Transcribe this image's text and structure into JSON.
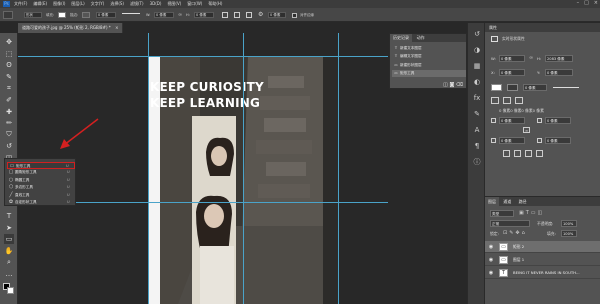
{
  "menubar": {
    "logo": "Ps",
    "items": [
      "文件(F)",
      "编辑(E)",
      "图像(I)",
      "图层(L)",
      "文字(Y)",
      "选择(S)",
      "滤镜(T)",
      "3D(D)",
      "视图(V)",
      "窗口(W)",
      "帮助(H)"
    ],
    "window_buttons": [
      "–",
      "□",
      "×"
    ]
  },
  "options": {
    "mode": "形状",
    "fill_label": "填充:",
    "stroke_label": "描边:",
    "stroke_width": "0 像素",
    "w_label": "W:",
    "w_value": "0 像素",
    "h_label": "H:",
    "h_value": "0 像素",
    "radius_value": "0 像素",
    "align_edges": "对齐边缘"
  },
  "tabs": [
    {
      "label": "道路可爱的孩子.jpg @ 25% (矩形 2, RGB/8#) *",
      "close": "×"
    }
  ],
  "toolbar": {
    "tools": [
      "move-icon",
      "marquee-icon",
      "lasso-icon",
      "quick-select-icon",
      "crop-icon",
      "eyedropper-icon",
      "heal-icon",
      "brush-icon",
      "stamp-icon",
      "history-brush-icon",
      "eraser-icon",
      "gradient-icon",
      "blur-icon",
      "dodge-icon",
      "pen-icon",
      "type-icon",
      "path-select-icon",
      "rectangle-icon",
      "hand-icon",
      "zoom-icon",
      "more-icon"
    ],
    "glyphs": [
      "✥",
      "⬚",
      "ʘ",
      "✎",
      "⌗",
      "✐",
      "✚",
      "✏",
      "⛉",
      "↺",
      "◫",
      "▦",
      "◉",
      "◐",
      "✒",
      "T",
      "➤",
      "▭",
      "✋",
      "⌕",
      "…"
    ]
  },
  "flyout": {
    "items": [
      {
        "label": "矩形工具",
        "key": "U",
        "glyph": "▭",
        "icon": "rectangle-tool-icon"
      },
      {
        "label": "圆角矩形工具",
        "key": "U",
        "glyph": "▢",
        "icon": "rounded-rectangle-tool-icon"
      },
      {
        "label": "椭圆工具",
        "key": "U",
        "glyph": "○",
        "icon": "ellipse-tool-icon"
      },
      {
        "label": "多边形工具",
        "key": "U",
        "glyph": "⬡",
        "icon": "polygon-tool-icon"
      },
      {
        "label": "直线工具",
        "key": "U",
        "glyph": "╱",
        "icon": "line-tool-icon"
      },
      {
        "label": "自定形状工具",
        "key": "U",
        "glyph": "✿",
        "icon": "custom-shape-tool-icon"
      }
    ]
  },
  "canvas": {
    "headline_1": "KEEP CURIOSITY",
    "headline_2": "KEEP LEARNING"
  },
  "history": {
    "tabs": [
      "历史记录",
      "动作"
    ],
    "rows": [
      {
        "label": "新建文本图层",
        "glyph": "T",
        "icon": "type-layer-icon"
      },
      {
        "label": "编辑文字图层",
        "glyph": "T",
        "icon": "type-layer-icon"
      },
      {
        "label": "新建形状图层",
        "glyph": "▭",
        "icon": "shape-layer-icon"
      },
      {
        "label": "矩形工具",
        "glyph": "▭",
        "icon": "rectangle-tool-icon"
      }
    ]
  },
  "properties": {
    "tab": "属性",
    "title": "实时形状属性",
    "w_label": "W:",
    "w_value": "0 像素",
    "h_label": "H:",
    "h_value": "2083 像素",
    "x_label": "X:",
    "x_value": "0 像素",
    "y_label": "Y:",
    "y_value": "0 像素",
    "stroke_value": "0 像素",
    "corner_label": "0 像素0 像素0 像素0 像素",
    "r1": "0 像素",
    "r2": "0 像素",
    "r3": "0 像素",
    "r4": "0 像素"
  },
  "layers": {
    "tabs": [
      "图层",
      "通道",
      "路径"
    ],
    "kind_label": "类型",
    "blend_mode": "正常",
    "opacity_label": "不透明度:",
    "opacity_value": "100%",
    "lock_label": "锁定:",
    "fill_label": "填充:",
    "fill_value": "100%",
    "rows": [
      {
        "name": "矩形 2",
        "selected": true,
        "glyph": "▭"
      },
      {
        "name": "图层 1",
        "selected": false,
        "glyph": "▭"
      },
      {
        "name": "BEING IT NEVER RAINS IN SOUTH...",
        "selected": false,
        "glyph": "T"
      }
    ]
  }
}
